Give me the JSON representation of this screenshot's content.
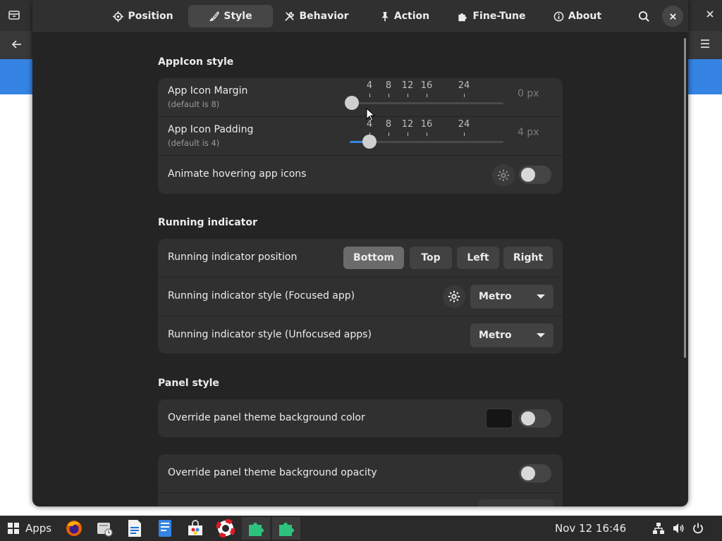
{
  "tabs": [
    {
      "label": "Position",
      "icon": "crosshair-icon"
    },
    {
      "label": "Style",
      "icon": "paintbrush-icon",
      "active": true
    },
    {
      "label": "Behavior",
      "icon": "tools-icon"
    },
    {
      "label": "Action",
      "icon": "pin-icon"
    },
    {
      "label": "Fine-Tune",
      "icon": "puzzle-icon"
    },
    {
      "label": "About",
      "icon": "info-icon"
    }
  ],
  "appicon_section": {
    "title": "AppIcon style",
    "margin": {
      "label": "App Icon Margin",
      "sub": "(default is 8)",
      "value_text": "0 px",
      "value": 0,
      "marks": [
        "4",
        "8",
        "12",
        "16",
        "24"
      ]
    },
    "padding": {
      "label": "App Icon Padding",
      "sub": "(default is 4)",
      "value_text": "4 px",
      "value": 4,
      "marks": [
        "4",
        "8",
        "12",
        "16",
        "24"
      ]
    },
    "animate": {
      "label": "Animate hovering app icons",
      "enabled": false
    }
  },
  "running_section": {
    "title": "Running indicator",
    "position": {
      "label": "Running indicator position",
      "options": [
        "Bottom",
        "Top",
        "Left",
        "Right"
      ],
      "selected": "Bottom"
    },
    "focused": {
      "label": "Running indicator style (Focused app)",
      "value": "Metro"
    },
    "unfocused": {
      "label": "Running indicator style (Unfocused apps)",
      "value": "Metro"
    }
  },
  "panel_section": {
    "title": "Panel style",
    "bg_color": {
      "label": "Override panel theme background color",
      "color": "#151515",
      "enabled": false
    },
    "bg_opacity": {
      "label": "Override panel theme background opacity",
      "enabled": false
    }
  },
  "taskbar": {
    "apps_label": "Apps",
    "clock": "Nov 12  16:46",
    "items": [
      "firefox-icon",
      "mail-client-icon",
      "document-editor-icon",
      "text-editor-icon",
      "software-store-icon",
      "help-lifebuoy-icon",
      "extension-puzzle-icon",
      "extension-puzzle-icon"
    ]
  },
  "colors": {
    "accent": "#3584e4",
    "background_blue": "#3584e4",
    "puzzle_green": "#2ec27e"
  }
}
